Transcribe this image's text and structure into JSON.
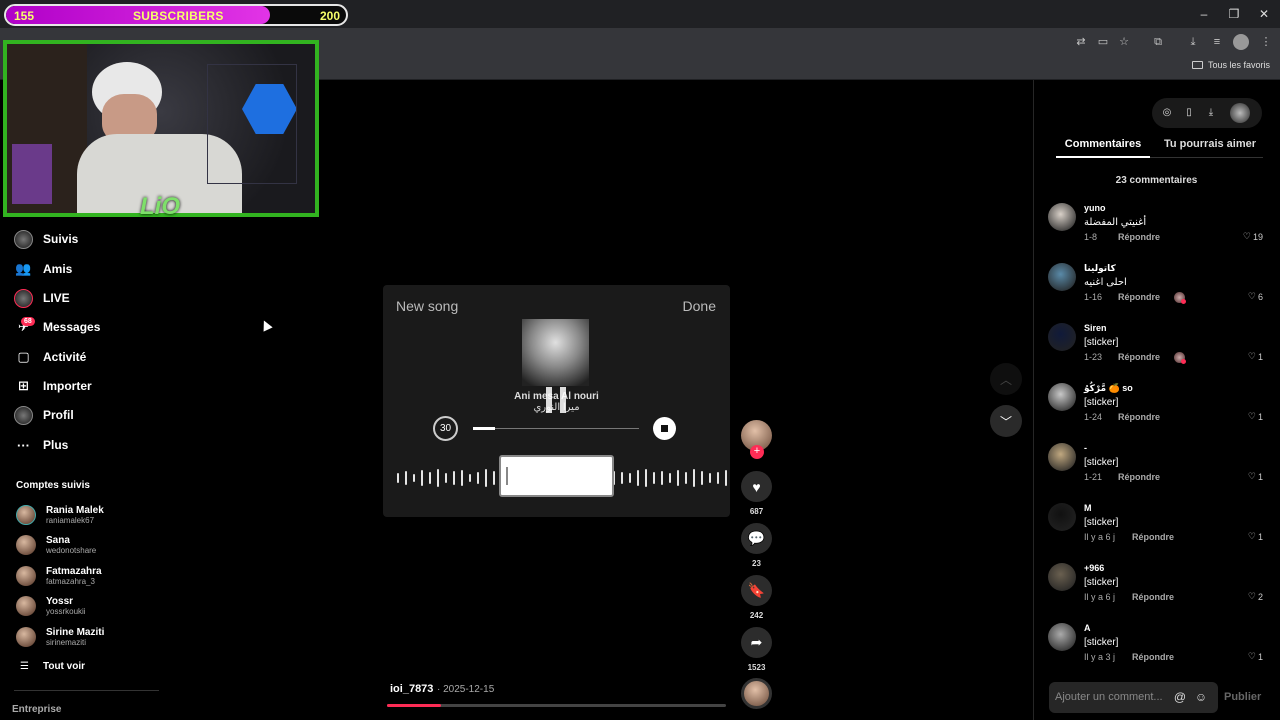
{
  "overlay": {
    "subscribers_current": "155",
    "subscribers_label": "SUBSCRIBERS",
    "subscribers_goal": "200",
    "progress_fraction": 0.775,
    "fill_color": "#e234e6",
    "text_color": "#f6ff6a",
    "webcam_border_color": "#32b320"
  },
  "browser": {
    "bookmarks_folder": "Tous les favoris",
    "toolbar_icons": [
      "translate-icon",
      "screen-cast-icon",
      "star-icon",
      "extensions-icon",
      "download-icon",
      "media-control-icon",
      "profile-avatar",
      "menu-dots-icon"
    ],
    "window_controls": [
      "minimize-icon",
      "restore-icon",
      "close-icon"
    ]
  },
  "sidebar": {
    "items": [
      {
        "label": "Suivis",
        "icon": "following-avatar"
      },
      {
        "label": "Amis",
        "icon": "friends-icon"
      },
      {
        "label": "LIVE",
        "icon": "live-avatar"
      },
      {
        "label": "Messages",
        "icon": "messages-icon",
        "badge": "68"
      },
      {
        "label": "Activité",
        "icon": "activity-icon"
      },
      {
        "label": "Importer",
        "icon": "upload-icon"
      },
      {
        "label": "Profil",
        "icon": "profile-avatar"
      },
      {
        "label": "Plus",
        "icon": "more-dots-icon"
      }
    ],
    "followed_title": "Comptes suivis",
    "accounts": [
      {
        "name": "Rania Malek",
        "handle": "raniamalek67"
      },
      {
        "name": "Sana",
        "handle": "wedonotshare"
      },
      {
        "name": "Fatmazahra",
        "handle": "fatmazahra_3"
      },
      {
        "name": "Yossr",
        "handle": "yossrkoukii"
      },
      {
        "name": "Sirine Maziti",
        "handle": "sirinemaziti"
      }
    ],
    "see_all": "Tout voir",
    "enterprise": "Entreprise"
  },
  "player": {
    "title": "New song",
    "done": "Done",
    "song_line1": "Ani mesa Al nouri",
    "song_line2": "ميرا النوري",
    "timer": "30",
    "seek_fraction": 0.13
  },
  "video": {
    "author": "ioi_7873",
    "date": "· 2025-12-15",
    "progress_fraction": 0.16,
    "accent_color": "#fe2c55"
  },
  "actions": {
    "likes": "687",
    "comments": "23",
    "saves": "242",
    "shares": "1523"
  },
  "right_panel": {
    "tab_comments": "Commentaires",
    "tab_like": "Tu pourrais aimer",
    "comment_count": "23 commentaires",
    "comments": [
      {
        "user": "yuno",
        "text": "أغنيتي المفضلة",
        "date": "1-8",
        "reply": "Répondre",
        "likes": "19",
        "creator_liked": false
      },
      {
        "user": "كاتولينا",
        "text": "احلى اغنيه",
        "date": "1-16",
        "reply": "Répondre",
        "likes": "6",
        "creator_liked": true
      },
      {
        "user": "Siren",
        "text": "[sticker]",
        "date": "1-23",
        "reply": "Répondre",
        "likes": "1",
        "creator_liked": true
      },
      {
        "user": "مَّرْكُوُ 🍊 so",
        "text": "[sticker]",
        "date": "1-24",
        "reply": "Répondre",
        "likes": "1",
        "creator_liked": false
      },
      {
        "user": "-",
        "text": "[sticker]",
        "date": "1-21",
        "reply": "Répondre",
        "likes": "1",
        "creator_liked": false
      },
      {
        "user": "M",
        "text": "[sticker]",
        "date": "Il y a 6 j",
        "reply": "Répondre",
        "likes": "1",
        "creator_liked": false
      },
      {
        "user": "+966",
        "text": "[sticker]",
        "date": "Il y a 6 j",
        "reply": "Répondre",
        "likes": "2",
        "creator_liked": false
      },
      {
        "user": "A",
        "text": "[sticker]",
        "date": "Il y a 3 j",
        "reply": "Répondre",
        "likes": "1",
        "creator_liked": false
      }
    ],
    "comment_placeholder": "Ajouter un comment...",
    "publish": "Publier"
  }
}
